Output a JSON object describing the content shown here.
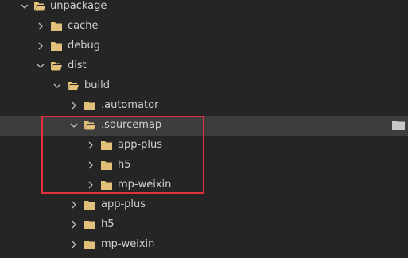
{
  "tree": {
    "items": [
      {
        "label": "unpackage",
        "expanded": true,
        "icon": "folder-open-icon"
      },
      {
        "label": "cache",
        "expanded": false,
        "icon": "folder-icon"
      },
      {
        "label": "debug",
        "expanded": false,
        "icon": "folder-icon"
      },
      {
        "label": "dist",
        "expanded": true,
        "icon": "folder-open-icon"
      },
      {
        "label": "build",
        "expanded": true,
        "icon": "folder-open-icon"
      },
      {
        "label": ".automator",
        "expanded": false,
        "icon": "folder-icon"
      },
      {
        "label": ".sourcemap",
        "expanded": true,
        "selected": true,
        "icon": "folder-open-icon"
      },
      {
        "label": "app-plus",
        "expanded": false,
        "icon": "folder-icon"
      },
      {
        "label": "h5",
        "expanded": false,
        "icon": "folder-icon"
      },
      {
        "label": "mp-weixin",
        "expanded": false,
        "icon": "folder-icon"
      },
      {
        "label": "app-plus",
        "expanded": false,
        "icon": "folder-icon"
      },
      {
        "label": "h5",
        "expanded": false,
        "icon": "folder-icon"
      },
      {
        "label": "mp-weixin",
        "expanded": false,
        "icon": "folder-icon"
      }
    ]
  },
  "colors": {
    "background": "#252525",
    "selected_row": "#3d3d3d",
    "text": "#d0d0d0",
    "folder": "#e3c07a",
    "chevron": "#bdbdbd",
    "highlight": "#e0303c"
  }
}
